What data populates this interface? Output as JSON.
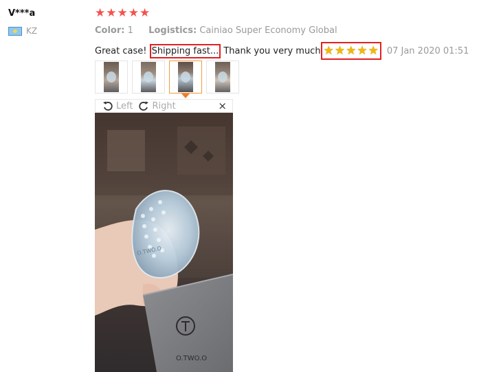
{
  "reviewer": {
    "name": "V***a",
    "country_code": "KZ",
    "flag_icon": "kazakhstan-flag-icon"
  },
  "rating": {
    "stars": 5,
    "color": "#f3514f"
  },
  "meta": {
    "color_label": "Color:",
    "color_value": "1",
    "logistics_label": "Logistics:",
    "logistics_value": "Cainiao Super Economy Global"
  },
  "review": {
    "text_before": "Great case! ",
    "highlight_1": "Shipping fast...",
    "text_after": " Thank you very much",
    "inline_stars": 5,
    "date": "07 Jan 2020 01:51"
  },
  "thumbnails": {
    "count": 4,
    "active_index": 2
  },
  "viewer": {
    "rotate_left_label": "Left",
    "rotate_right_label": "Right",
    "close_glyph": "×",
    "pouch_brand": "O.TWO.O",
    "case_brand": "O.TWO.O"
  },
  "colors": {
    "highlight_border": "#e02020",
    "accent_orange": "#f07c26",
    "muted_text": "#999999"
  }
}
